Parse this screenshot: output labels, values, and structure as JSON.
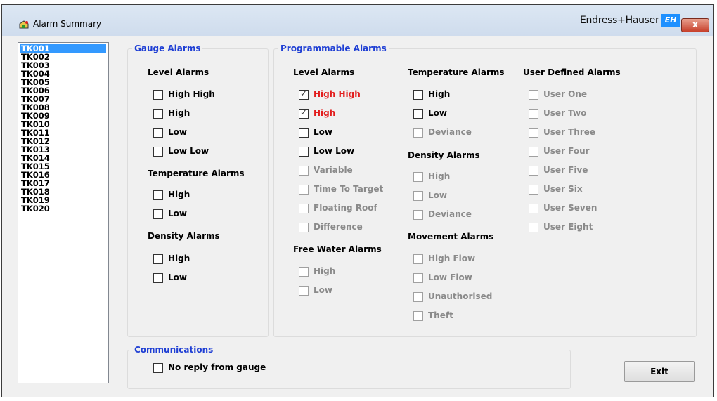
{
  "window": {
    "title": "Alarm Summary",
    "brand": "Endress+Hauser",
    "brand_mark": "EH",
    "close_label": "x"
  },
  "tanks": [
    "TK001",
    "TK002",
    "TK003",
    "TK004",
    "TK005",
    "TK006",
    "TK007",
    "TK008",
    "TK009",
    "TK010",
    "TK011",
    "TK012",
    "TK013",
    "TK014",
    "TK015",
    "TK016",
    "TK017",
    "TK018",
    "TK019",
    "TK020"
  ],
  "selected_tank": "TK001",
  "gauge": {
    "title": "Gauge Alarms",
    "level_title": "Level Alarms",
    "level": [
      {
        "label": "High High",
        "checked": false,
        "enabled": true,
        "active": false
      },
      {
        "label": "High",
        "checked": false,
        "enabled": true,
        "active": false
      },
      {
        "label": "Low",
        "checked": false,
        "enabled": true,
        "active": false
      },
      {
        "label": "Low Low",
        "checked": false,
        "enabled": true,
        "active": false
      }
    ],
    "temp_title": "Temperature Alarms",
    "temp": [
      {
        "label": "High",
        "checked": false,
        "enabled": true,
        "active": false
      },
      {
        "label": "Low",
        "checked": false,
        "enabled": true,
        "active": false
      }
    ],
    "density_title": "Density Alarms",
    "density": [
      {
        "label": "High",
        "checked": false,
        "enabled": true,
        "active": false
      },
      {
        "label": "Low",
        "checked": false,
        "enabled": true,
        "active": false
      }
    ]
  },
  "prog": {
    "title": "Programmable Alarms",
    "level_title": "Level Alarms",
    "level": [
      {
        "label": "High High",
        "checked": true,
        "enabled": true,
        "active": true
      },
      {
        "label": "High",
        "checked": true,
        "enabled": true,
        "active": true
      },
      {
        "label": "Low",
        "checked": false,
        "enabled": true,
        "active": false
      },
      {
        "label": "Low Low",
        "checked": false,
        "enabled": true,
        "active": false
      },
      {
        "label": "Variable",
        "checked": false,
        "enabled": false,
        "active": false
      },
      {
        "label": "Time To Target",
        "checked": false,
        "enabled": false,
        "active": false
      },
      {
        "label": "Floating Roof",
        "checked": false,
        "enabled": false,
        "active": false
      },
      {
        "label": "Difference",
        "checked": false,
        "enabled": false,
        "active": false
      }
    ],
    "freewater_title": "Free Water Alarms",
    "freewater": [
      {
        "label": "High",
        "checked": false,
        "enabled": false,
        "active": false
      },
      {
        "label": "Low",
        "checked": false,
        "enabled": false,
        "active": false
      }
    ],
    "temp_title": "Temperature Alarms",
    "temp": [
      {
        "label": "High",
        "checked": false,
        "enabled": true,
        "active": false
      },
      {
        "label": "Low",
        "checked": false,
        "enabled": true,
        "active": false
      },
      {
        "label": "Deviance",
        "checked": false,
        "enabled": false,
        "active": false
      }
    ],
    "density_title": "Density Alarms",
    "density": [
      {
        "label": "High",
        "checked": false,
        "enabled": false,
        "active": false
      },
      {
        "label": "Low",
        "checked": false,
        "enabled": false,
        "active": false
      },
      {
        "label": "Deviance",
        "checked": false,
        "enabled": false,
        "active": false
      }
    ],
    "movement_title": "Movement Alarms",
    "movement": [
      {
        "label": "High Flow",
        "checked": false,
        "enabled": false,
        "active": false
      },
      {
        "label": "Low Flow",
        "checked": false,
        "enabled": false,
        "active": false
      },
      {
        "label": "Unauthorised",
        "checked": false,
        "enabled": false,
        "active": false
      },
      {
        "label": "Theft",
        "checked": false,
        "enabled": false,
        "active": false
      }
    ],
    "user_title": "User Defined Alarms",
    "user": [
      {
        "label": "User One",
        "checked": false,
        "enabled": false,
        "active": false
      },
      {
        "label": "User Two",
        "checked": false,
        "enabled": false,
        "active": false
      },
      {
        "label": "User Three",
        "checked": false,
        "enabled": false,
        "active": false
      },
      {
        "label": "User Four",
        "checked": false,
        "enabled": false,
        "active": false
      },
      {
        "label": "User Five",
        "checked": false,
        "enabled": false,
        "active": false
      },
      {
        "label": "User Six",
        "checked": false,
        "enabled": false,
        "active": false
      },
      {
        "label": "User Seven",
        "checked": false,
        "enabled": false,
        "active": false
      },
      {
        "label": "User Eight",
        "checked": false,
        "enabled": false,
        "active": false
      }
    ]
  },
  "comms": {
    "title": "Communications",
    "items": [
      {
        "label": "No reply from gauge",
        "checked": false,
        "enabled": true,
        "active": false
      }
    ]
  },
  "buttons": {
    "exit": "Exit"
  },
  "colors": {
    "group_title": "#1f3fd4",
    "alarm": "#e21c1c",
    "disabled": "#8a8a8a",
    "selection": "#3399ff"
  }
}
